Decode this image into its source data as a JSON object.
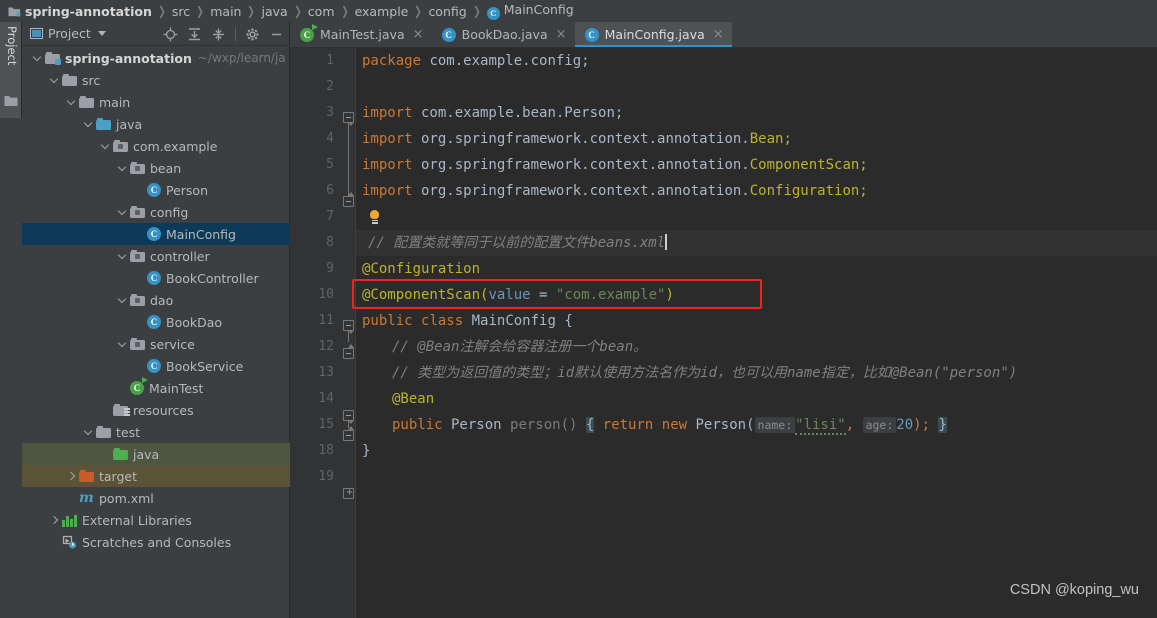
{
  "breadcrumb": {
    "items": [
      {
        "label": "spring-annotation",
        "icon": "folder-icon",
        "bold": true
      },
      {
        "label": "src",
        "icon": "none",
        "bold": false
      },
      {
        "label": "main",
        "icon": "none",
        "bold": false
      },
      {
        "label": "java",
        "icon": "none",
        "bold": false
      },
      {
        "label": "com",
        "icon": "none",
        "bold": false
      },
      {
        "label": "example",
        "icon": "none",
        "bold": false
      },
      {
        "label": "config",
        "icon": "none",
        "bold": false
      },
      {
        "label": "MainConfig",
        "icon": "class-icon",
        "bold": false
      }
    ],
    "separator": "❯"
  },
  "tool_stripe": {
    "tab_label": "Project",
    "folder_icon": "folder-icon"
  },
  "project_panel": {
    "title": "Project",
    "caret": "chevron-down-icon",
    "header_icons": [
      "locate-target-icon",
      "expand-all-icon",
      "collapse-all-icon",
      "gear-icon",
      "minimize-icon"
    ],
    "tree": [
      {
        "indent": 0,
        "twisty": "down",
        "icon": "module-folder-icon",
        "label": "spring-annotation",
        "bold": true,
        "hint": "~/wxp/learn/ja",
        "state": "none"
      },
      {
        "indent": 1,
        "twisty": "down",
        "icon": "folder-grey-icon",
        "label": "src",
        "bold": false,
        "hint": "",
        "state": "none"
      },
      {
        "indent": 2,
        "twisty": "down",
        "icon": "folder-grey-icon",
        "label": "main",
        "bold": false,
        "hint": "",
        "state": "none"
      },
      {
        "indent": 3,
        "twisty": "down",
        "icon": "source-folder-icon",
        "label": "java",
        "bold": false,
        "hint": "",
        "state": "none"
      },
      {
        "indent": 4,
        "twisty": "down",
        "icon": "package-icon",
        "label": "com.example",
        "bold": false,
        "hint": "",
        "state": "none"
      },
      {
        "indent": 5,
        "twisty": "down",
        "icon": "package-icon",
        "label": "bean",
        "bold": false,
        "hint": "",
        "state": "none"
      },
      {
        "indent": 6,
        "twisty": "none",
        "icon": "class-icon",
        "label": "Person",
        "bold": false,
        "hint": "",
        "state": "none"
      },
      {
        "indent": 5,
        "twisty": "down",
        "icon": "package-icon",
        "label": "config",
        "bold": false,
        "hint": "",
        "state": "none"
      },
      {
        "indent": 6,
        "twisty": "none",
        "icon": "class-icon",
        "label": "MainConfig",
        "bold": false,
        "hint": "",
        "state": "selected"
      },
      {
        "indent": 5,
        "twisty": "down",
        "icon": "package-icon",
        "label": "controller",
        "bold": false,
        "hint": "",
        "state": "none"
      },
      {
        "indent": 6,
        "twisty": "none",
        "icon": "class-icon",
        "label": "BookController",
        "bold": false,
        "hint": "",
        "state": "none"
      },
      {
        "indent": 5,
        "twisty": "down",
        "icon": "package-icon",
        "label": "dao",
        "bold": false,
        "hint": "",
        "state": "none"
      },
      {
        "indent": 6,
        "twisty": "none",
        "icon": "class-icon",
        "label": "BookDao",
        "bold": false,
        "hint": "",
        "state": "none"
      },
      {
        "indent": 5,
        "twisty": "down",
        "icon": "package-icon",
        "label": "service",
        "bold": false,
        "hint": "",
        "state": "none"
      },
      {
        "indent": 6,
        "twisty": "none",
        "icon": "class-icon",
        "label": "BookService",
        "bold": false,
        "hint": "",
        "state": "none"
      },
      {
        "indent": 5,
        "twisty": "none",
        "icon": "runnable-class-icon",
        "label": "MainTest",
        "bold": false,
        "hint": "",
        "state": "none"
      },
      {
        "indent": 4,
        "twisty": "none",
        "icon": "resources-folder-icon",
        "label": "resources",
        "bold": false,
        "hint": "",
        "state": "none"
      },
      {
        "indent": 3,
        "twisty": "down",
        "icon": "folder-grey-icon",
        "label": "test",
        "bold": false,
        "hint": "",
        "state": "none"
      },
      {
        "indent": 4,
        "twisty": "none",
        "icon": "test-source-folder-icon",
        "label": "java",
        "bold": false,
        "hint": "",
        "state": "green"
      },
      {
        "indent": 2,
        "twisty": "right",
        "icon": "excluded-folder-icon",
        "label": "target",
        "bold": false,
        "hint": "",
        "state": "brown"
      },
      {
        "indent": 2,
        "twisty": "none",
        "icon": "maven-icon",
        "label": "pom.xml",
        "bold": false,
        "hint": "",
        "state": "none"
      },
      {
        "indent": 1,
        "twisty": "right",
        "icon": "libraries-icon",
        "label": "External Libraries",
        "bold": false,
        "hint": "",
        "state": "none"
      },
      {
        "indent": 1,
        "twisty": "none",
        "icon": "scratches-icon",
        "label": "Scratches and Consoles",
        "bold": false,
        "hint": "",
        "state": "none"
      }
    ]
  },
  "editor": {
    "tabs": [
      {
        "label": "MainTest.java",
        "icon": "runnable-class-icon",
        "active": false,
        "close": "×"
      },
      {
        "label": "BookDao.java",
        "icon": "class-icon",
        "active": false,
        "close": "×"
      },
      {
        "label": "MainConfig.java",
        "icon": "class-icon",
        "active": true,
        "close": "×"
      }
    ],
    "gutter_numbers": [
      "1",
      "2",
      "3",
      "4",
      "5",
      "6",
      "7",
      "8",
      "9",
      "10",
      "11",
      "12",
      "13",
      "14",
      "15",
      "18",
      "19"
    ],
    "highlighted_line": "8",
    "caret_line": "8",
    "code": {
      "l1_package_kw": "package",
      "l1_package_name": " com.example.config;",
      "l3_import_kw": "import",
      "l3_rest": " com.example.bean.Person;",
      "l4_import_kw": "import",
      "l4_pkg": " org.springframework.context.annotation.",
      "l4_cls": "Bean;",
      "l5_import_kw": "import",
      "l5_pkg": " org.springframework.context.annotation.",
      "l5_cls": "ComponentScan;",
      "l6_import_kw": "import",
      "l6_pkg": " org.springframework.context.annotation.",
      "l6_cls": "Configuration;",
      "l7_bulb": "intention-bulb-icon",
      "l8_comment": "// 配置类就等同于以前的配置文件beans.xml",
      "l9_annotation": "@Configuration",
      "l10_annotation": "@ComponentScan(",
      "l10_attr": "value",
      "l10_eq": " = ",
      "l10_value": "\"com.example\"",
      "l10_close": ")",
      "l11_mod": "public",
      "l11_kw": "class",
      "l11_name": " MainConfig ",
      "l11_brace": "{",
      "l12_comment": "// @Bean注解会给容器注册一个bean。",
      "l13_comment": "// 类型为返回值的类型；id默认使用方法名作为id，也可以用name指定，比如@Bean(\"person\")",
      "l14_annotation": "@Bean",
      "l15_mod": "public",
      "l15_type": " Person ",
      "l15_method": "person()",
      "l15_brace_open": "{",
      "l15_return": "return",
      "l15_new": "new",
      "l15_ctor": " Person(",
      "l15_hint_name": "name:",
      "l15_arg_name": "\"lisi\"",
      "l15_comma": ", ",
      "l15_hint_age": "age:",
      "l15_arg_age": "20",
      "l15_semi": ");",
      "l15_brace_close": "}",
      "l18_brace": "}"
    }
  },
  "annotation": {
    "type": "red-rectangle-highlight",
    "target_line": "10",
    "color": "#f4211c"
  },
  "watermark": {
    "text": "CSDN @koping_wu"
  },
  "colors": {
    "chrome_bg": "#3c3f41",
    "editor_bg": "#2b2b2b",
    "gutter_bg": "#313335",
    "accent": "#3592c4",
    "selection": "#0d3a58",
    "keyword": "#cc7832",
    "annotation_yellow": "#bbb529",
    "string_green": "#6a8759",
    "number_blue": "#6897bb",
    "text": "#a9b7c6",
    "comment": "#808080",
    "highlight_red": "#f4211c"
  }
}
